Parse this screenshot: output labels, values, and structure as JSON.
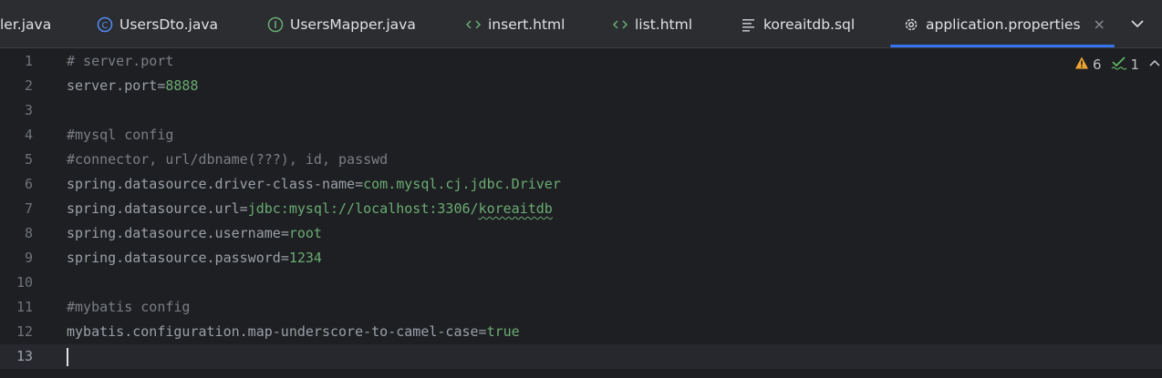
{
  "tabs": [
    {
      "label": "ler.java",
      "icon": "java-file-icon",
      "active": false
    },
    {
      "label": "UsersDto.java",
      "icon": "class-icon",
      "active": false
    },
    {
      "label": "UsersMapper.java",
      "icon": "interface-icon",
      "active": false
    },
    {
      "label": "insert.html",
      "icon": "html-icon",
      "active": false
    },
    {
      "label": "list.html",
      "icon": "html-icon",
      "active": false
    },
    {
      "label": "koreaitdb.sql",
      "icon": "sql-file-icon",
      "active": false
    },
    {
      "label": "application.properties",
      "icon": "gear-icon",
      "active": true
    }
  ],
  "close_glyph": "×",
  "inspections": {
    "warnings": "6",
    "typos": "1"
  },
  "lines": [
    {
      "n": "1",
      "comment": "# server.port"
    },
    {
      "n": "2",
      "key": "server.port",
      "eq": "=",
      "value": "8888"
    },
    {
      "n": "3"
    },
    {
      "n": "4",
      "comment": "#mysql config"
    },
    {
      "n": "5",
      "comment": "#connector, url/dbname(???), id, passwd"
    },
    {
      "n": "6",
      "key": "spring.datasource.driver-class-name",
      "eq": "=",
      "value": "com.mysql.cj.jdbc.Driver"
    },
    {
      "n": "7",
      "key": "spring.datasource.url",
      "eq": "=",
      "value": "jdbc:mysql://localhost:3306/",
      "value2": "koreaitdb"
    },
    {
      "n": "8",
      "key": "spring.datasource.username",
      "eq": "=",
      "value": "root"
    },
    {
      "n": "9",
      "key": "spring.datasource.password",
      "eq": "=",
      "value": "1234"
    },
    {
      "n": "10"
    },
    {
      "n": "11",
      "comment": "#mybatis config"
    },
    {
      "n": "12",
      "key": "mybatis.configuration.map-underscore-to-camel-case",
      "eq": "=",
      "value": "true"
    },
    {
      "n": "13"
    }
  ],
  "colors": {
    "accent": "#3574f0",
    "value": "#6aab73",
    "warning": "#f0a732",
    "check": "#5fb865"
  }
}
